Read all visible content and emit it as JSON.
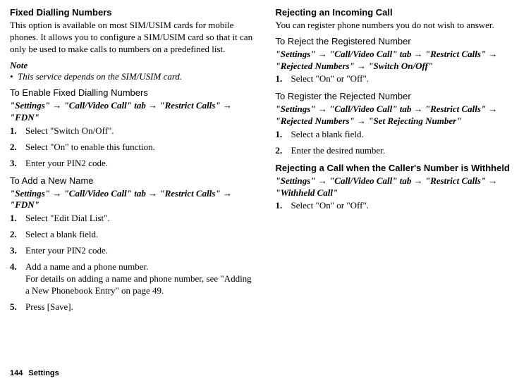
{
  "left": {
    "heading": "Fixed Dialling Numbers",
    "desc": "This option is available on most SIM/USIM cards for mobile phones. It allows you to configure a SIM/USIM card so that it can only be used to make calls to numbers on a predefined list.",
    "noteHead": "Note",
    "noteBullet": "•",
    "noteText": "This service depends on the SIM/USIM card.",
    "sub1": "To Enable Fixed Dialling Numbers",
    "path1": {
      "p1": "\"Settings\"",
      "p2": "\"Call/Video Call\" tab",
      "p3": "\"Restrict Calls\"",
      "p4": "\"FDN\""
    },
    "steps1": [
      "Select \"Switch On/Off\".",
      "Select \"On\" to enable this function.",
      "Enter your PIN2 code."
    ],
    "sub2": "To Add a New Name",
    "path2": {
      "p1": "\"Settings\"",
      "p2": "\"Call/Video Call\" tab",
      "p3": "\"Restrict Calls\"",
      "p4": "\"FDN\""
    },
    "steps2": [
      "Select \"Edit Dial List\".",
      "Select a blank field.",
      "Enter your PIN2 code.",
      "Add a name and a phone number.\nFor details on adding a name and phone number, see \"Adding a New Phonebook Entry\" on page 49.",
      "Press [Save]."
    ]
  },
  "right": {
    "heading": "Rejecting an Incoming Call",
    "desc": "You can register phone numbers you do not wish to answer.",
    "sub1": "To Reject the Registered Number",
    "path1": {
      "p1": "\"Settings\"",
      "p2": "\"Call/Video Call\" tab",
      "p3": "\"Restrict Calls\"",
      "p4": "\"Rejected Numbers\"",
      "p5": "\"Switch On/Off\""
    },
    "steps1": [
      "Select \"On\" or \"Off\"."
    ],
    "sub2": "To Register the Rejected Number",
    "path2": {
      "p1": "\"Settings\"",
      "p2": "\"Call/Video Call\" tab",
      "p3": "\"Restrict Calls\"",
      "p4": "\"Rejected Numbers\"",
      "p5": "\"Set Rejecting Number\""
    },
    "steps2": [
      "Select a blank field.",
      "Enter the desired number."
    ],
    "heading2": "Rejecting a Call when the Caller's Number is Withheld",
    "path3": {
      "p1": "\"Settings\"",
      "p2": "\"Call/Video Call\" tab",
      "p3": "\"Restrict Calls\"",
      "p4": "\"Withheld Call\""
    },
    "steps3": [
      "Select \"On\" or \"Off\"."
    ]
  },
  "footer": {
    "page": "144",
    "section": "Settings"
  },
  "arrow": "→"
}
